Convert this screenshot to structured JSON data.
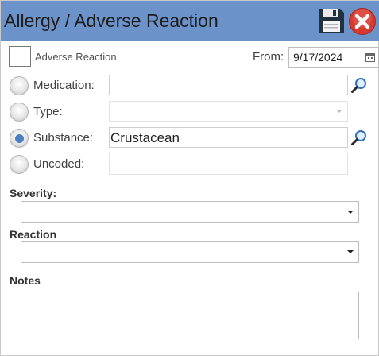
{
  "header": {
    "title": "Allergy / Adverse Reaction",
    "save_icon": "floppy-disk-icon",
    "close_icon": "close-x-icon"
  },
  "adverse_reaction": {
    "label": "Adverse Reaction",
    "checked": false
  },
  "from": {
    "label": "From:",
    "value": "9/17/2024",
    "icon": "calendar-icon"
  },
  "options": {
    "medication": {
      "label": "Medication:",
      "value": "",
      "selected": false
    },
    "type": {
      "label": "Type:",
      "value": "",
      "selected": false
    },
    "substance": {
      "label": "Substance:",
      "value": "Crustacean",
      "selected": true
    },
    "uncoded": {
      "label": "Uncoded:",
      "value": "",
      "selected": false
    }
  },
  "severity": {
    "label": "Severity:",
    "value": ""
  },
  "reaction": {
    "label": "Reaction",
    "value": ""
  },
  "notes": {
    "label": "Notes",
    "value": ""
  },
  "colors": {
    "titlebar": "#6b92c9",
    "radio_selected": "#4a7fc6",
    "close_red": "#d63a2f"
  }
}
